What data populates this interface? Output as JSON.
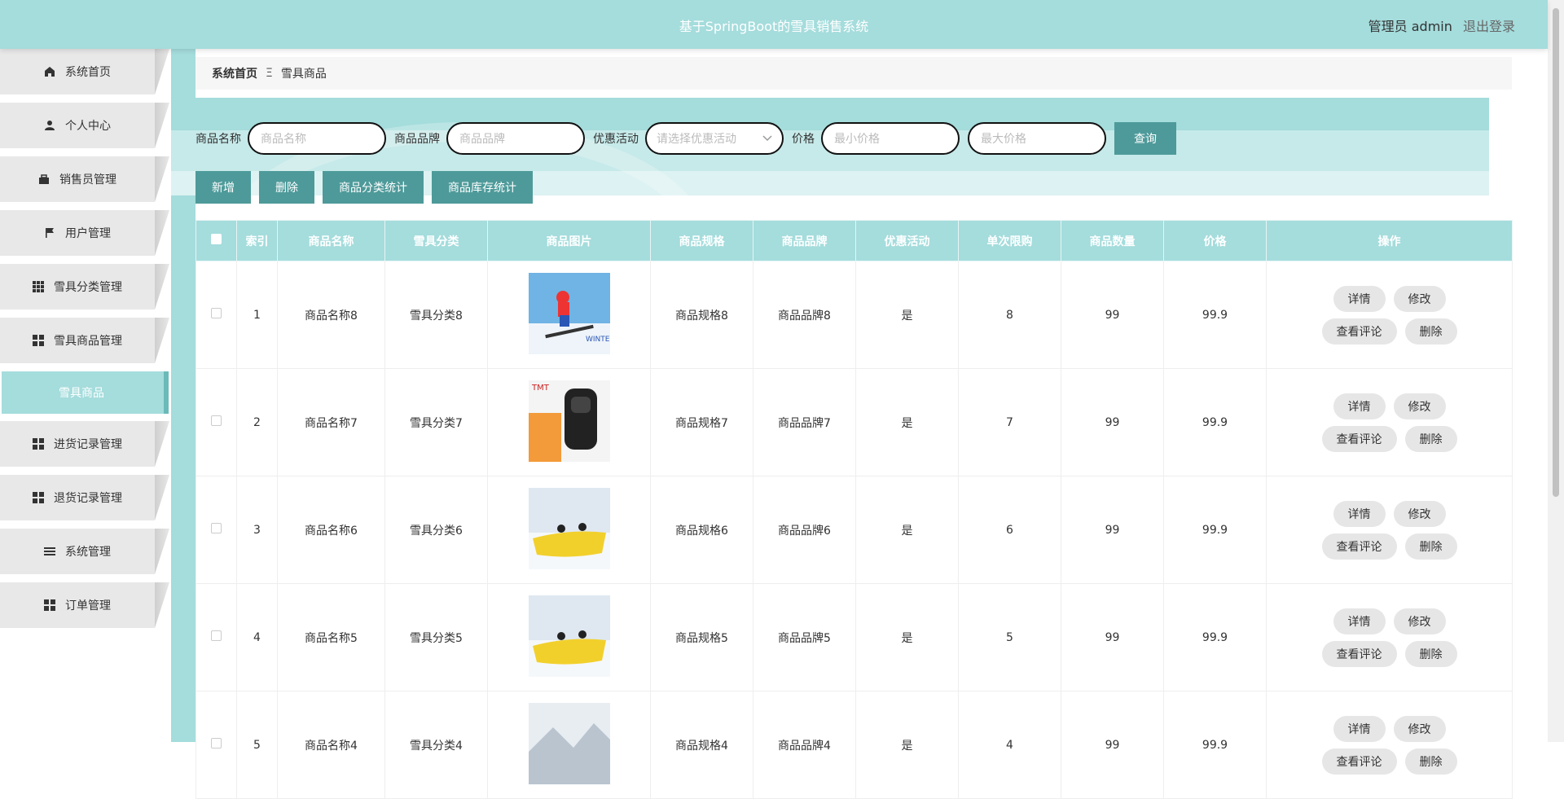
{
  "header": {
    "title": "基于SpringBoot的雪具销售系统",
    "user_label": "管理员 admin",
    "logout": "退出登录"
  },
  "sidebar": {
    "items": [
      {
        "label": "系统首页",
        "icon": "home-icon"
      },
      {
        "label": "个人中心",
        "icon": "user-icon"
      },
      {
        "label": "销售员管理",
        "icon": "briefcase-icon"
      },
      {
        "label": "用户管理",
        "icon": "flag-icon"
      },
      {
        "label": "雪具分类管理",
        "icon": "grid-icon"
      },
      {
        "label": "雪具商品管理",
        "icon": "grid-icon"
      }
    ],
    "submenu_active": "雪具商品",
    "items2": [
      {
        "label": "进货记录管理",
        "icon": "grid-icon"
      },
      {
        "label": "退货记录管理",
        "icon": "grid-icon"
      },
      {
        "label": "系统管理",
        "icon": "menu-icon"
      },
      {
        "label": "订单管理",
        "icon": "grid-icon"
      }
    ]
  },
  "breadcrumb": {
    "home": "系统首页",
    "sep": "Ξ",
    "current": "雪具商品"
  },
  "filters": {
    "name_label": "商品名称",
    "name_placeholder": "商品名称",
    "brand_label": "商品品牌",
    "brand_placeholder": "商品品牌",
    "promo_label": "优惠活动",
    "promo_placeholder": "请选择优惠活动",
    "price_label": "价格",
    "min_placeholder": "最小价格",
    "max_placeholder": "最大价格",
    "search": "查询"
  },
  "actions": {
    "add": "新增",
    "delete": "删除",
    "cat_stats": "商品分类统计",
    "stock_stats": "商品库存统计"
  },
  "table": {
    "headers": [
      "",
      "索引",
      "商品名称",
      "雪具分类",
      "商品图片",
      "商品规格",
      "商品品牌",
      "优惠活动",
      "单次限购",
      "商品数量",
      "价格",
      "操作"
    ],
    "ops": {
      "detail": "详情",
      "edit": "修改",
      "comments": "查看评论",
      "delete": "删除"
    },
    "rows": [
      {
        "idx": "1",
        "name": "商品名称8",
        "cat": "雪具分类8",
        "spec": "商品规格8",
        "brand": "商品品牌8",
        "promo": "是",
        "limit": "8",
        "qty": "99",
        "price": "99.9"
      },
      {
        "idx": "2",
        "name": "商品名称7",
        "cat": "雪具分类7",
        "spec": "商品规格7",
        "brand": "商品品牌7",
        "promo": "是",
        "limit": "7",
        "qty": "99",
        "price": "99.9"
      },
      {
        "idx": "3",
        "name": "商品名称6",
        "cat": "雪具分类6",
        "spec": "商品规格6",
        "brand": "商品品牌6",
        "promo": "是",
        "limit": "6",
        "qty": "99",
        "price": "99.9"
      },
      {
        "idx": "4",
        "name": "商品名称5",
        "cat": "雪具分类5",
        "spec": "商品规格5",
        "brand": "商品品牌5",
        "promo": "是",
        "limit": "5",
        "qty": "99",
        "price": "99.9"
      },
      {
        "idx": "5",
        "name": "商品名称4",
        "cat": "雪具分类4",
        "spec": "商品规格4",
        "brand": "商品品牌4",
        "promo": "是",
        "limit": "4",
        "qty": "99",
        "price": "99.9"
      }
    ]
  },
  "colors": {
    "accent": "#a5dcdc",
    "button": "#4e9a9a"
  }
}
